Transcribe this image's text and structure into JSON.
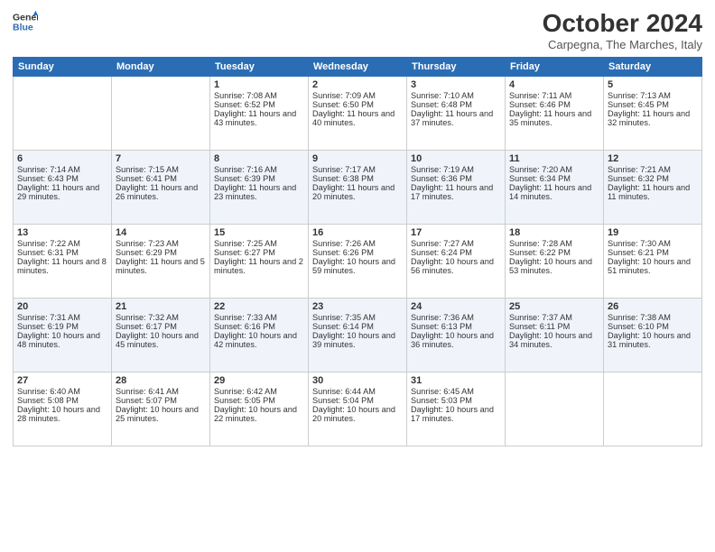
{
  "header": {
    "logo_line1": "General",
    "logo_line2": "Blue",
    "month": "October 2024",
    "location": "Carpegna, The Marches, Italy"
  },
  "days_of_week": [
    "Sunday",
    "Monday",
    "Tuesday",
    "Wednesday",
    "Thursday",
    "Friday",
    "Saturday"
  ],
  "weeks": [
    [
      {
        "day": "",
        "data": ""
      },
      {
        "day": "",
        "data": ""
      },
      {
        "day": "1",
        "data": "Sunrise: 7:08 AM\nSunset: 6:52 PM\nDaylight: 11 hours and 43 minutes."
      },
      {
        "day": "2",
        "data": "Sunrise: 7:09 AM\nSunset: 6:50 PM\nDaylight: 11 hours and 40 minutes."
      },
      {
        "day": "3",
        "data": "Sunrise: 7:10 AM\nSunset: 6:48 PM\nDaylight: 11 hours and 37 minutes."
      },
      {
        "day": "4",
        "data": "Sunrise: 7:11 AM\nSunset: 6:46 PM\nDaylight: 11 hours and 35 minutes."
      },
      {
        "day": "5",
        "data": "Sunrise: 7:13 AM\nSunset: 6:45 PM\nDaylight: 11 hours and 32 minutes."
      }
    ],
    [
      {
        "day": "6",
        "data": "Sunrise: 7:14 AM\nSunset: 6:43 PM\nDaylight: 11 hours and 29 minutes."
      },
      {
        "day": "7",
        "data": "Sunrise: 7:15 AM\nSunset: 6:41 PM\nDaylight: 11 hours and 26 minutes."
      },
      {
        "day": "8",
        "data": "Sunrise: 7:16 AM\nSunset: 6:39 PM\nDaylight: 11 hours and 23 minutes."
      },
      {
        "day": "9",
        "data": "Sunrise: 7:17 AM\nSunset: 6:38 PM\nDaylight: 11 hours and 20 minutes."
      },
      {
        "day": "10",
        "data": "Sunrise: 7:19 AM\nSunset: 6:36 PM\nDaylight: 11 hours and 17 minutes."
      },
      {
        "day": "11",
        "data": "Sunrise: 7:20 AM\nSunset: 6:34 PM\nDaylight: 11 hours and 14 minutes."
      },
      {
        "day": "12",
        "data": "Sunrise: 7:21 AM\nSunset: 6:32 PM\nDaylight: 11 hours and 11 minutes."
      }
    ],
    [
      {
        "day": "13",
        "data": "Sunrise: 7:22 AM\nSunset: 6:31 PM\nDaylight: 11 hours and 8 minutes."
      },
      {
        "day": "14",
        "data": "Sunrise: 7:23 AM\nSunset: 6:29 PM\nDaylight: 11 hours and 5 minutes."
      },
      {
        "day": "15",
        "data": "Sunrise: 7:25 AM\nSunset: 6:27 PM\nDaylight: 11 hours and 2 minutes."
      },
      {
        "day": "16",
        "data": "Sunrise: 7:26 AM\nSunset: 6:26 PM\nDaylight: 10 hours and 59 minutes."
      },
      {
        "day": "17",
        "data": "Sunrise: 7:27 AM\nSunset: 6:24 PM\nDaylight: 10 hours and 56 minutes."
      },
      {
        "day": "18",
        "data": "Sunrise: 7:28 AM\nSunset: 6:22 PM\nDaylight: 10 hours and 53 minutes."
      },
      {
        "day": "19",
        "data": "Sunrise: 7:30 AM\nSunset: 6:21 PM\nDaylight: 10 hours and 51 minutes."
      }
    ],
    [
      {
        "day": "20",
        "data": "Sunrise: 7:31 AM\nSunset: 6:19 PM\nDaylight: 10 hours and 48 minutes."
      },
      {
        "day": "21",
        "data": "Sunrise: 7:32 AM\nSunset: 6:17 PM\nDaylight: 10 hours and 45 minutes."
      },
      {
        "day": "22",
        "data": "Sunrise: 7:33 AM\nSunset: 6:16 PM\nDaylight: 10 hours and 42 minutes."
      },
      {
        "day": "23",
        "data": "Sunrise: 7:35 AM\nSunset: 6:14 PM\nDaylight: 10 hours and 39 minutes."
      },
      {
        "day": "24",
        "data": "Sunrise: 7:36 AM\nSunset: 6:13 PM\nDaylight: 10 hours and 36 minutes."
      },
      {
        "day": "25",
        "data": "Sunrise: 7:37 AM\nSunset: 6:11 PM\nDaylight: 10 hours and 34 minutes."
      },
      {
        "day": "26",
        "data": "Sunrise: 7:38 AM\nSunset: 6:10 PM\nDaylight: 10 hours and 31 minutes."
      }
    ],
    [
      {
        "day": "27",
        "data": "Sunrise: 6:40 AM\nSunset: 5:08 PM\nDaylight: 10 hours and 28 minutes."
      },
      {
        "day": "28",
        "data": "Sunrise: 6:41 AM\nSunset: 5:07 PM\nDaylight: 10 hours and 25 minutes."
      },
      {
        "day": "29",
        "data": "Sunrise: 6:42 AM\nSunset: 5:05 PM\nDaylight: 10 hours and 22 minutes."
      },
      {
        "day": "30",
        "data": "Sunrise: 6:44 AM\nSunset: 5:04 PM\nDaylight: 10 hours and 20 minutes."
      },
      {
        "day": "31",
        "data": "Sunrise: 6:45 AM\nSunset: 5:03 PM\nDaylight: 10 hours and 17 minutes."
      },
      {
        "day": "",
        "data": ""
      },
      {
        "day": "",
        "data": ""
      }
    ]
  ]
}
